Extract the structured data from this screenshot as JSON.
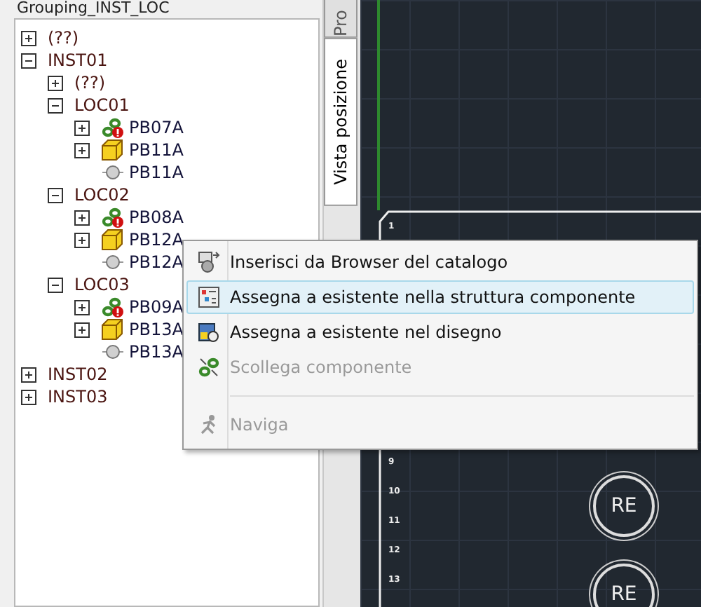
{
  "panel": {
    "title": "Grouping_INST_LOC"
  },
  "tree": [
    {
      "label": "(??)",
      "kind": "group",
      "expanded": false
    },
    {
      "label": "INST01",
      "kind": "group",
      "expanded": true,
      "children": [
        {
          "label": "(??)",
          "kind": "group",
          "expanded": false
        },
        {
          "label": "LOC01",
          "kind": "group",
          "expanded": true,
          "children": [
            {
              "label": "PB07A",
              "kind": "link",
              "expanded": false
            },
            {
              "label": "PB11A",
              "kind": "part",
              "expanded": false
            },
            {
              "label": "PB11A",
              "kind": "point"
            }
          ]
        },
        {
          "label": "LOC02",
          "kind": "group",
          "expanded": true,
          "children": [
            {
              "label": "PB08A",
              "kind": "link",
              "expanded": false
            },
            {
              "label": "PB12A",
              "kind": "part",
              "expanded": false
            },
            {
              "label": "PB12A",
              "kind": "point"
            }
          ]
        },
        {
          "label": "LOC03",
          "kind": "group",
          "expanded": true,
          "children": [
            {
              "label": "PB09A",
              "kind": "link",
              "expanded": false
            },
            {
              "label": "PB13A",
              "kind": "part",
              "expanded": false
            },
            {
              "label": "PB13A",
              "kind": "point"
            }
          ]
        }
      ]
    },
    {
      "label": "INST02",
      "kind": "group",
      "expanded": false
    },
    {
      "label": "INST03",
      "kind": "group",
      "expanded": false
    }
  ],
  "side_tabs": [
    {
      "label": "Pro",
      "selected": false
    },
    {
      "label": "Vista posizione",
      "selected": true
    }
  ],
  "canvas": {
    "row_numbers": [
      "1",
      "9",
      "10",
      "11",
      "12",
      "13"
    ],
    "symbols": [
      "RE",
      "RE"
    ]
  },
  "context_menu": [
    {
      "kind": "item",
      "label": "Inserisci da Browser del catalogo",
      "selected": false,
      "disabled": false
    },
    {
      "kind": "item",
      "label": "Assegna a esistente nella struttura componente",
      "selected": true,
      "disabled": false
    },
    {
      "kind": "item",
      "label": "Assegna a esistente nel disegno",
      "selected": false,
      "disabled": false
    },
    {
      "kind": "item",
      "label": "Scollega componente",
      "selected": false,
      "disabled": true
    },
    {
      "kind": "separator"
    },
    {
      "kind": "item",
      "label": "Naviga",
      "selected": false,
      "disabled": true
    }
  ]
}
